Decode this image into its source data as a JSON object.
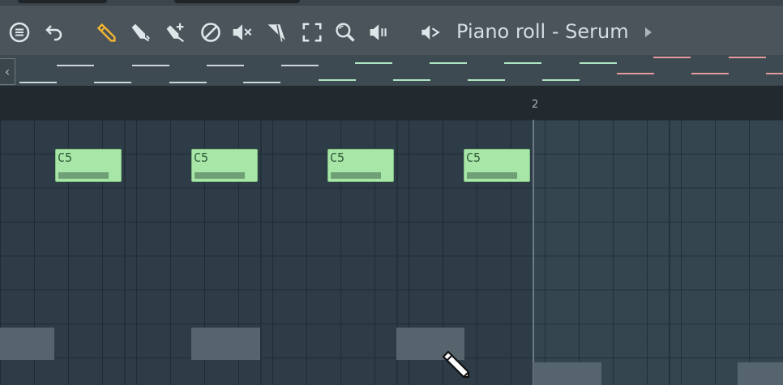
{
  "toolbar": {
    "title": "Piano roll - Serum",
    "tools": [
      {
        "icon": "menu-icon"
      },
      {
        "icon": "undo-icon"
      },
      {
        "icon": "pencil-icon"
      },
      {
        "icon": "paint-icon"
      },
      {
        "icon": "paint-add-icon"
      },
      {
        "icon": "delete-icon"
      },
      {
        "icon": "mute-icon"
      },
      {
        "icon": "slice-icon"
      },
      {
        "icon": "select-icon"
      },
      {
        "icon": "zoom-icon"
      },
      {
        "icon": "playback-icon"
      },
      {
        "icon": "speaker-icon"
      }
    ],
    "accent_color": "#f2b531"
  },
  "timeline": {
    "bar_number": "2"
  },
  "notes": [
    {
      "label": "C5"
    },
    {
      "label": "C5"
    },
    {
      "label": "C5"
    },
    {
      "label": "C5"
    }
  ],
  "colors": {
    "note_fill": "#a8e6a8",
    "grid_bg": "#344550",
    "overview_green": "#aee5c2",
    "overview_red": "#e59a9a"
  }
}
